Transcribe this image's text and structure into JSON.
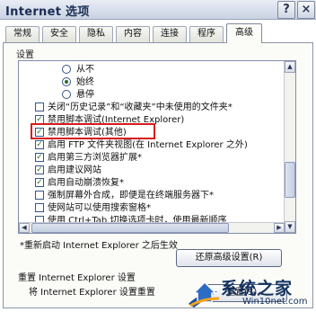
{
  "window": {
    "title": "Internet 选项",
    "help_icon": "?",
    "close_icon": "×"
  },
  "tabs": [
    {
      "label": "常规",
      "active": false
    },
    {
      "label": "安全",
      "active": false
    },
    {
      "label": "隐私",
      "active": false
    },
    {
      "label": "内容",
      "active": false
    },
    {
      "label": "连接",
      "active": false
    },
    {
      "label": "程序",
      "active": false
    },
    {
      "label": "高级",
      "active": true
    }
  ],
  "settings": {
    "group_label": "设置",
    "items": [
      {
        "type": "radio",
        "checked": false,
        "indent": 1,
        "label": "从不"
      },
      {
        "type": "radio",
        "checked": true,
        "indent": 1,
        "label": "始终"
      },
      {
        "type": "radio",
        "checked": false,
        "indent": 1,
        "label": "悬停"
      },
      {
        "type": "checkbox",
        "checked": false,
        "indent": 0,
        "label": "关闭“历史记录”和“收藏夹”中未使用的文件夹*"
      },
      {
        "type": "checkbox",
        "checked": true,
        "indent": 0,
        "label": "禁用脚本调试(Internet Explorer)"
      },
      {
        "type": "checkbox",
        "checked": true,
        "indent": 0,
        "label": "禁用脚本调试(其他)",
        "highlighted": true
      },
      {
        "type": "checkbox",
        "checked": true,
        "indent": 0,
        "label": "启用 FTP 文件夹视图(在 Internet Explorer 之外)"
      },
      {
        "type": "checkbox",
        "checked": true,
        "indent": 0,
        "label": "启用第三方浏览器扩展*"
      },
      {
        "type": "checkbox",
        "checked": true,
        "indent": 0,
        "label": "启用建议网站"
      },
      {
        "type": "checkbox",
        "checked": true,
        "indent": 0,
        "label": "启用自动崩溃恢复*"
      },
      {
        "type": "checkbox",
        "checked": false,
        "indent": 0,
        "label": "强制屏幕外合成，即便是在终端服务器下*"
      },
      {
        "type": "checkbox",
        "checked": false,
        "indent": 0,
        "label": "使网站可以使用搜索窗格*"
      },
      {
        "type": "checkbox",
        "checked": false,
        "indent": 0,
        "label": "使用 Ctrl+Tab 切换选项卡时，使用最新顺序"
      }
    ],
    "note": "*重新启动 Internet Explorer 之后生效",
    "restore_button": "还原高级设置(R)"
  },
  "reset": {
    "line1": "重置 Internet Explorer 设置",
    "line2": "将 Internet Explorer 设置重置",
    "button": "重置(S)..."
  },
  "watermark": {
    "brand": "系统之家",
    "url": "Win10net.com"
  }
}
